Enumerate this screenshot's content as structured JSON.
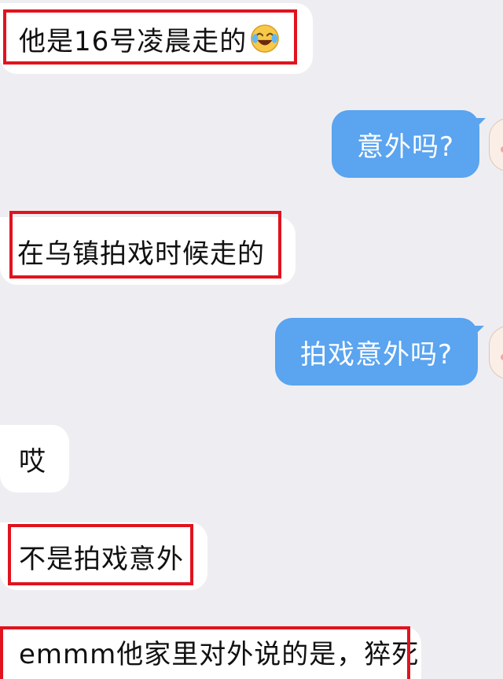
{
  "messages": [
    {
      "side": "in",
      "text": "他是16号凌晨走的",
      "emoji": "laugh-cry-emoji",
      "highlighted": true
    },
    {
      "side": "out",
      "text": "意外吗?"
    },
    {
      "side": "in",
      "text": "在乌镇拍戏时候走的",
      "highlighted": true
    },
    {
      "side": "out",
      "text": "拍戏意外吗?"
    },
    {
      "side": "in",
      "text": "哎"
    },
    {
      "side": "in",
      "text": "不是拍戏意外",
      "highlighted": true
    },
    {
      "side": "in",
      "text": "emmm他家里对外说的是，猝死",
      "highlighted": true
    }
  ],
  "colors": {
    "background": "#eeeef2",
    "incoming_bubble": "#ffffff",
    "outgoing_bubble": "#5aa4f0",
    "highlight_box": "#e0131e"
  }
}
